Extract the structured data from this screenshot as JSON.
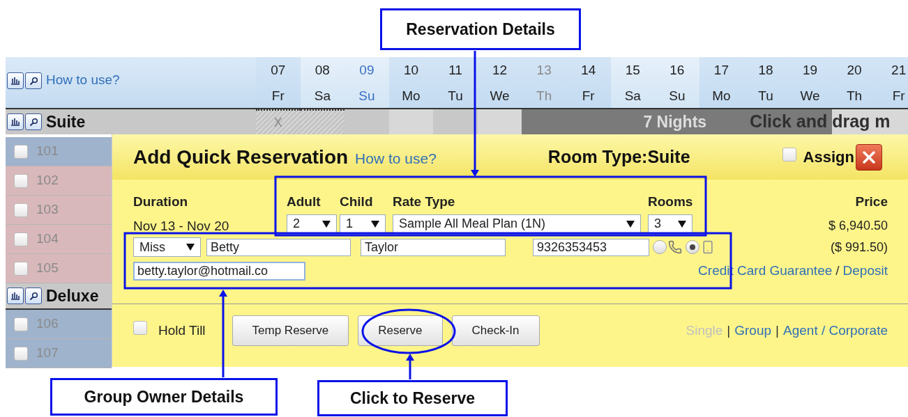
{
  "grid": {
    "help_link": "How to use?",
    "days": [
      {
        "date": "07",
        "weekday": "Fr",
        "weekend": false,
        "color": "#222222"
      },
      {
        "date": "08",
        "weekday": "Sa",
        "weekend": true,
        "color": "#222222"
      },
      {
        "date": "09",
        "weekday": "Su",
        "weekend": true,
        "color": "#3a6fc4"
      },
      {
        "date": "10",
        "weekday": "Mo",
        "weekend": false,
        "color": "#222222"
      },
      {
        "date": "11",
        "weekday": "Tu",
        "weekend": false,
        "color": "#222222"
      },
      {
        "date": "12",
        "weekday": "We",
        "weekend": false,
        "color": "#222222"
      },
      {
        "date": "13",
        "weekday": "Th",
        "weekend": false,
        "color": "#888888"
      },
      {
        "date": "14",
        "weekday": "Fr",
        "weekend": false,
        "color": "#222222"
      },
      {
        "date": "15",
        "weekday": "Sa",
        "weekend": true,
        "color": "#222222"
      },
      {
        "date": "16",
        "weekday": "Su",
        "weekend": true,
        "color": "#222222"
      },
      {
        "date": "17",
        "weekday": "Mo",
        "weekend": false,
        "color": "#222222"
      },
      {
        "date": "18",
        "weekday": "Tu",
        "weekend": false,
        "color": "#222222"
      },
      {
        "date": "19",
        "weekday": "We",
        "weekend": false,
        "color": "#222222"
      },
      {
        "date": "20",
        "weekday": "Th",
        "weekend": false,
        "color": "#222222"
      },
      {
        "date": "21",
        "weekday": "Fr",
        "weekend": false,
        "color": "#222222"
      }
    ],
    "suite_row": {
      "name": "Suite",
      "cells": [
        {
          "kind": "blocked",
          "mark": "X"
        },
        {
          "kind": "blocked"
        },
        {
          "kind": "free"
        },
        {
          "kind": "light"
        },
        {
          "kind": "free"
        },
        {
          "kind": "light"
        },
        {
          "kind": "selected"
        },
        {
          "kind": "selected"
        },
        {
          "kind": "selected"
        },
        {
          "kind": "selected"
        },
        {
          "kind": "selected"
        },
        {
          "kind": "selected"
        },
        {
          "kind": "selected"
        },
        {
          "kind": "light"
        },
        {
          "kind": "light"
        }
      ],
      "nights": "7 Nights",
      "hint": "Click and drag m"
    },
    "rows": [
      {
        "kind": "room",
        "number": "101",
        "color": "#9fb3cc",
        "checked": false
      },
      {
        "kind": "room",
        "number": "102",
        "color": "#d9b8bb",
        "checked": false
      },
      {
        "kind": "room",
        "number": "103",
        "color": "#d9b8bb",
        "checked": false
      },
      {
        "kind": "room",
        "number": "104",
        "color": "#d9b8bb",
        "checked": false
      },
      {
        "kind": "room",
        "number": "105",
        "color": "#d9b8bb",
        "checked": false
      },
      {
        "kind": "type",
        "name": "Deluxe"
      },
      {
        "kind": "room",
        "number": "106",
        "color": "#9fb3cc",
        "checked": false
      },
      {
        "kind": "room",
        "number": "107",
        "color": "#9fb3cc",
        "checked": false
      }
    ]
  },
  "dialog": {
    "title": "Add Quick Reservation",
    "help_link": "How to use?",
    "room_type_label": "Room Type:",
    "room_type": "Suite",
    "assign": {
      "label": "Assign",
      "checked": false
    },
    "duration": {
      "label": "Duration",
      "value": "Nov 13 - Nov 20"
    },
    "adult": {
      "label": "Adult",
      "value": "2"
    },
    "child": {
      "label": "Child",
      "value": "1"
    },
    "rate_type": {
      "label": "Rate Type",
      "value": "Sample All Meal Plan (1N)"
    },
    "rooms": {
      "label": "Rooms",
      "value": "3"
    },
    "price": {
      "label": "Price",
      "total": "$ 6,940.50",
      "per_night": "($ 991.50)"
    },
    "guest": {
      "salutation": "Miss",
      "first_name": "Betty",
      "last_name": "Taylor",
      "phone": "9326353453",
      "email": "betty.taylor@hotmail.co",
      "phone_types": [
        {
          "kind": "landline",
          "selected": false
        },
        {
          "kind": "mobile",
          "selected": true
        }
      ]
    },
    "payment_links": [
      {
        "kind": "link",
        "text": "Credit Card Guarantee"
      },
      {
        "kind": "separator",
        "text": "/"
      },
      {
        "kind": "link",
        "text": "Deposit"
      }
    ],
    "hold_till": {
      "label": "Hold Till",
      "checked": false
    },
    "buttons": [
      "Temp Reserve",
      "Reserve",
      "Check-In"
    ],
    "modes": [
      {
        "kind": "mode",
        "text": "Single",
        "selected": true
      },
      {
        "kind": "separator",
        "text": "|"
      },
      {
        "kind": "mode",
        "text": "Group",
        "selected": false
      },
      {
        "kind": "separator",
        "text": "|"
      },
      {
        "kind": "mode",
        "text": "Agent / Corporate",
        "selected": false
      }
    ]
  },
  "callouts": [
    "Reservation Details",
    "Group Owner Details",
    "Click to Reserve"
  ]
}
